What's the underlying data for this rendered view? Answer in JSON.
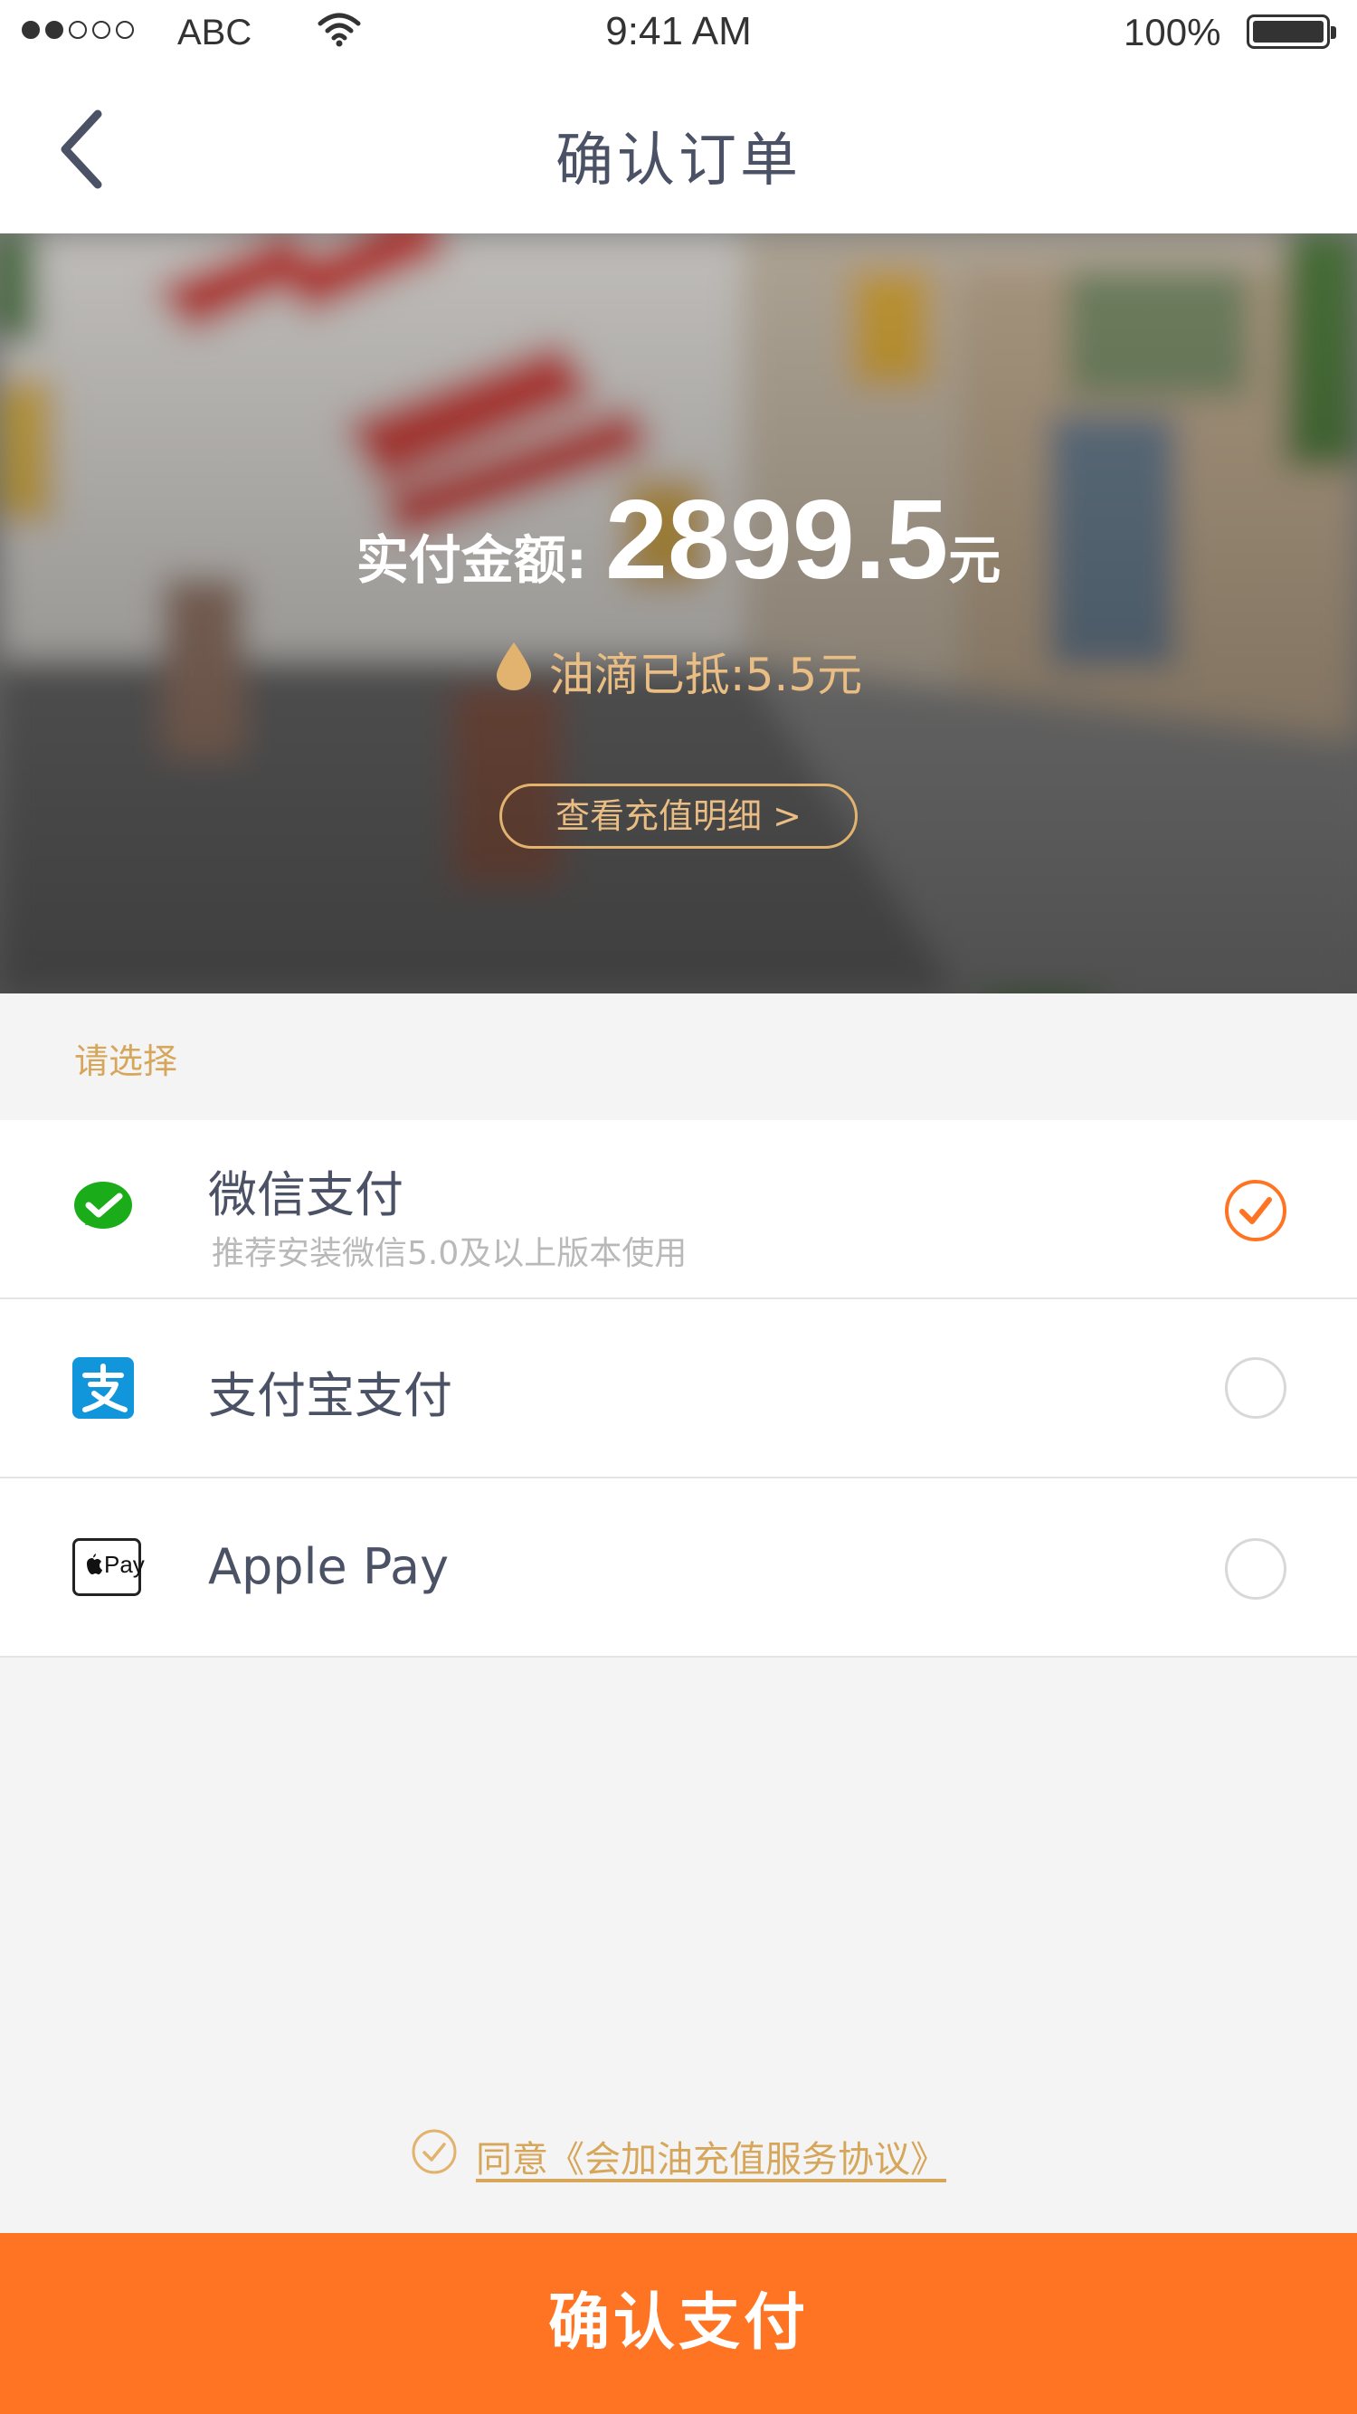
{
  "status_bar": {
    "carrier": "ABC",
    "time": "9:41 AM",
    "battery": "100%"
  },
  "nav": {
    "title": "确认订单",
    "back_icon": "chevron-left-icon"
  },
  "hero": {
    "amount_label": "实付金额:",
    "amount_value": "2899.5",
    "amount_unit": "元",
    "deduction_text": "油滴已抵:5.5元",
    "detail_button": "查看充值明细 >"
  },
  "section_label": "请选择",
  "payment_methods": [
    {
      "name": "微信支付",
      "subtitle": "推荐安装微信5.0及以上版本使用",
      "icon": "wechat-pay-icon",
      "selected": true
    },
    {
      "name": "支付宝支付",
      "icon": "alipay-icon",
      "selected": false
    },
    {
      "name": "Apple Pay",
      "icon": "apple-pay-icon",
      "icon_text": "Pay",
      "selected": false
    }
  ],
  "agreement": {
    "text": "同意《会加油充值服务协议》",
    "checked": true
  },
  "confirm_button": "确认支付",
  "colors": {
    "accent": "#ff7422",
    "gold": "#e9bd83",
    "wechat_green": "#1aad19",
    "alipay_blue": "#1296db"
  }
}
